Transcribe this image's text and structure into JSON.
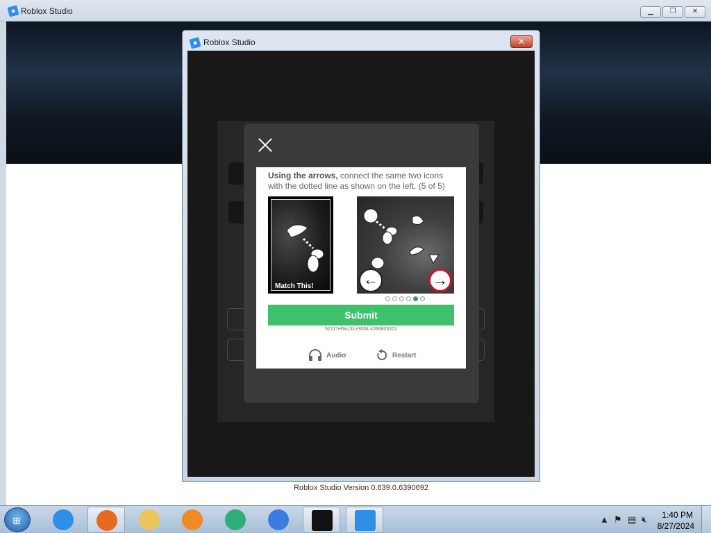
{
  "outer_window": {
    "title": "Roblox Studio",
    "minimize_icon": "minimize-icon",
    "maximize_icon": "restore-icon",
    "close_icon": "close-icon"
  },
  "version_text": "Roblox Studio Version 0.639.0.6390692",
  "inner_window": {
    "title": "Roblox Studio",
    "close_icon": "close-icon"
  },
  "captcha": {
    "instructions_bold": "Using the arrows,",
    "instructions_rest": " connect the same two icons with the dotted line as shown on the left. (5 of 5)",
    "match_label": "Match This!",
    "progress": {
      "total": 6,
      "active": 5
    },
    "submit_label": "Submit",
    "session_id": "52117ef9cc31e3004.4066605201",
    "audio_label": "Audio",
    "restart_label": "Restart",
    "left_arrow": "←",
    "right_arrow": "→"
  },
  "taskbar": {
    "items": [
      {
        "name": "internet-explorer-icon",
        "color": "#2f8fe6"
      },
      {
        "name": "firefox-icon",
        "color": "#e66a1f"
      },
      {
        "name": "file-explorer-icon",
        "color": "#e9c55b"
      },
      {
        "name": "media-player-icon",
        "color": "#f08a24"
      },
      {
        "name": "edge-icon",
        "color": "#2fae7a"
      },
      {
        "name": "chrome-icon",
        "color": "#3b7ddd"
      },
      {
        "name": "command-prompt-icon",
        "color": "#111111"
      },
      {
        "name": "roblox-studio-icon",
        "color": "#2f8fe6"
      }
    ],
    "clock_time": "1:40 PM",
    "clock_date": "8/27/2024"
  }
}
